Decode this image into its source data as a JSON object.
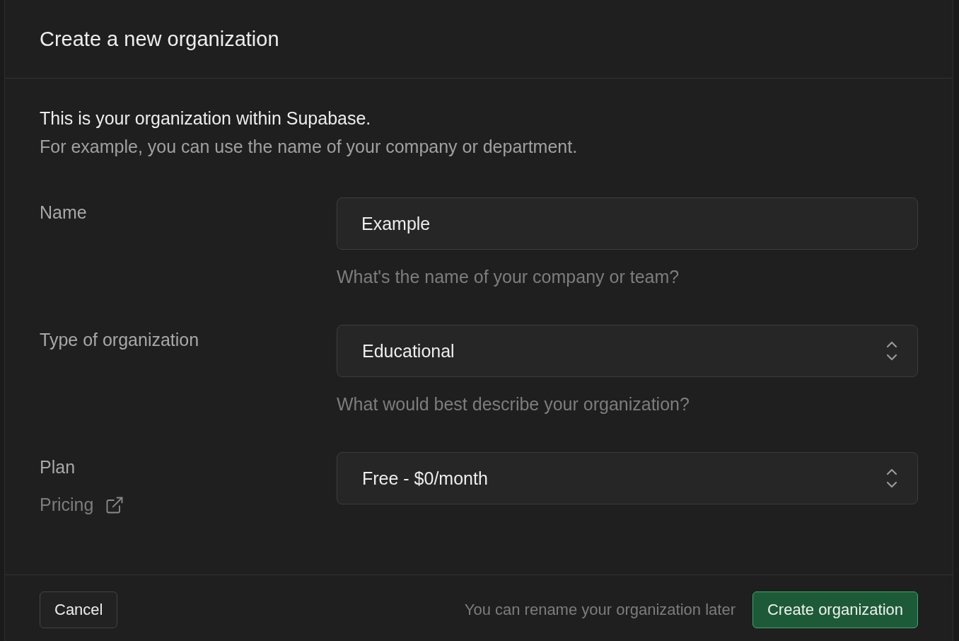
{
  "dialog": {
    "title": "Create a new organization",
    "intro": {
      "lead": "This is your organization within Supabase.",
      "detail": "For example, you can use the name of your company or department."
    },
    "fields": [
      {
        "kind": "text",
        "label": "Name",
        "value": "Example",
        "hint": "What's the name of your company or team?"
      },
      {
        "kind": "select",
        "label": "Type of organization",
        "value": "Educational",
        "hint": "What would best describe your organization?"
      },
      {
        "kind": "select",
        "label": "Plan",
        "value": "Free - $0/month",
        "link": "Pricing"
      }
    ],
    "footer": {
      "cancel": "Cancel",
      "note": "You can rename your organization later",
      "submit": "Create organization"
    }
  }
}
